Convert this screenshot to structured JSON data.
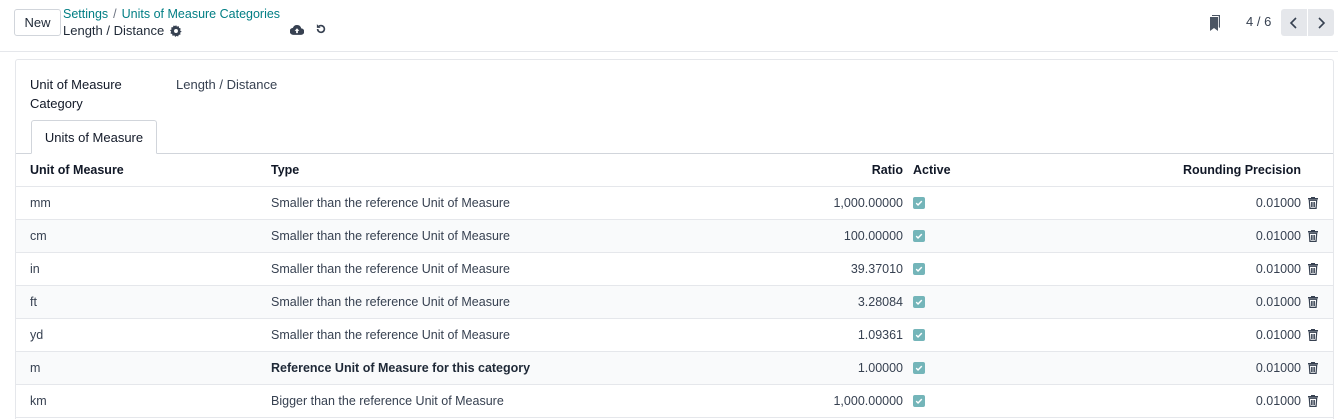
{
  "control_panel": {
    "new_label": "New",
    "breadcrumb": [
      {
        "label": "Settings"
      },
      {
        "label": "Units of Measure Categories"
      }
    ],
    "breadcrumb_separator": "/",
    "record_name": "Length / Distance",
    "pager": "4 / 6"
  },
  "form": {
    "category_label": "Unit of Measure Category",
    "category_value": "Length / Distance",
    "tab_label": "Units of Measure"
  },
  "table": {
    "headers": {
      "uom": "Unit of Measure",
      "type": "Type",
      "ratio": "Ratio",
      "active": "Active",
      "rounding": "Rounding Precision"
    },
    "rows": [
      {
        "uom": "mm",
        "type": "Smaller than the reference Unit of Measure",
        "ratio": "1,000.00000",
        "active": true,
        "rounding": "0.01000"
      },
      {
        "uom": "cm",
        "type": "Smaller than the reference Unit of Measure",
        "ratio": "100.00000",
        "active": true,
        "rounding": "0.01000"
      },
      {
        "uom": "in",
        "type": "Smaller than the reference Unit of Measure",
        "ratio": "39.37010",
        "active": true,
        "rounding": "0.01000"
      },
      {
        "uom": "ft",
        "type": "Smaller than the reference Unit of Measure",
        "ratio": "3.28084",
        "active": true,
        "rounding": "0.01000"
      },
      {
        "uom": "yd",
        "type": "Smaller than the reference Unit of Measure",
        "ratio": "1.09361",
        "active": true,
        "rounding": "0.01000"
      },
      {
        "uom": "m",
        "type": "Reference Unit of Measure for this category",
        "ratio": "1.00000",
        "active": true,
        "rounding": "0.01000"
      },
      {
        "uom": "km",
        "type": "Bigger than the reference Unit of Measure",
        "ratio": "1,000.00000",
        "active": true,
        "rounding": "0.01000"
      }
    ]
  },
  "colors": {
    "accent": "#017e84",
    "checkbox": "#74b5b9"
  }
}
